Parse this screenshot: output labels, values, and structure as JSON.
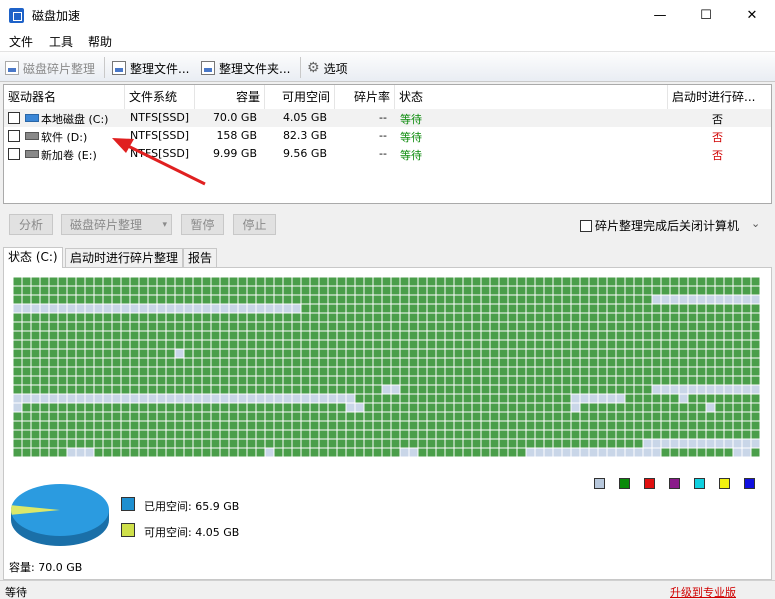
{
  "window": {
    "title": "磁盘加速",
    "minimize_glyph": "—",
    "maximize_glyph": "☐",
    "close_glyph": "✕"
  },
  "menu": [
    "文件",
    "工具",
    "帮助"
  ],
  "toolbar": {
    "defrag_label": "磁盘碎片整理",
    "defrag_files_label": "整理文件...",
    "defrag_folder_label": "整理文件夹...",
    "options_label": "选项"
  },
  "drive_table": {
    "columns": [
      "驱动器名",
      "文件系统",
      "容量",
      "可用空间",
      "碎片率",
      "状态",
      "启动时进行碎..."
    ],
    "rows": [
      {
        "name": "本地磁盘 (C:)",
        "fs": "NTFS[SSD]",
        "capacity": "70.0 GB",
        "free": "4.05 GB",
        "frag": "--",
        "status": "等待",
        "boot": "否"
      },
      {
        "name": "软件 (D:)",
        "fs": "NTFS[SSD]",
        "capacity": "158 GB",
        "free": "82.3 GB",
        "frag": "--",
        "status": "等待",
        "boot": "否"
      },
      {
        "name": "新加卷 (E:)",
        "fs": "NTFS[SSD]",
        "capacity": "9.99 GB",
        "free": "9.56 GB",
        "frag": "--",
        "status": "等待",
        "boot": "否"
      }
    ]
  },
  "actions": {
    "analyze": "分析",
    "defrag": "磁盘碎片整理",
    "pause": "暂停",
    "stop": "停止",
    "shutdown_checkbox": "碎片整理完成后关闭计算机"
  },
  "tabs": [
    "状态 (C:)",
    "启动时进行碎片整理",
    "报告"
  ],
  "legend_colors": [
    "#b8c8dc",
    "#0a8a0a",
    "#e01010",
    "#8a1a8a",
    "#10d0e0",
    "#f0f010",
    "#1010e0"
  ],
  "colors": {
    "used_block": "#4a9e4a",
    "free_block": "#c9d6e8",
    "used_space": "#1e8fd0",
    "free_space": "#cfe04a"
  },
  "pie": {
    "used_label": "已用空间: 65.9 GB",
    "free_label": "可用空间: 4.05 GB",
    "capacity_label": "容量: 70.0 GB",
    "used_fraction": 0.942
  },
  "statusbar": {
    "status": "等待",
    "upgrade_link": "升级到专业版"
  }
}
